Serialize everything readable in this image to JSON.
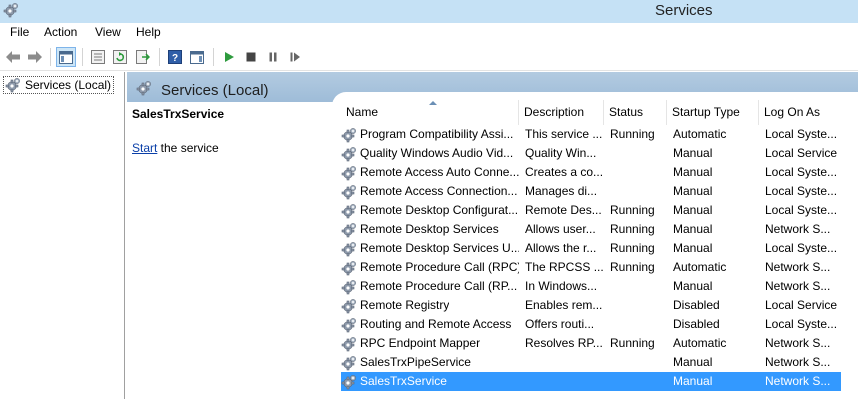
{
  "window": {
    "title": "Services"
  },
  "menu": [
    "File",
    "Action",
    "View",
    "Help"
  ],
  "tree": {
    "root_label": "Services (Local)"
  },
  "content_header": {
    "title": "Services (Local)"
  },
  "description_pane": {
    "service_name": "SalesTrxService",
    "start_link": "Start",
    "start_suffix": " the service"
  },
  "columns": [
    "Name",
    "Description",
    "Status",
    "Startup Type",
    "Log On As"
  ],
  "services": [
    {
      "name": "Program Compatibility Assi...",
      "description": "This service ...",
      "status": "Running",
      "startup": "Automatic",
      "logon": "Local Syste..."
    },
    {
      "name": "Quality Windows Audio Vid...",
      "description": "Quality Win...",
      "status": "",
      "startup": "Manual",
      "logon": "Local Service"
    },
    {
      "name": "Remote Access Auto Conne...",
      "description": "Creates a co...",
      "status": "",
      "startup": "Manual",
      "logon": "Local Syste..."
    },
    {
      "name": "Remote Access Connection...",
      "description": "Manages di...",
      "status": "",
      "startup": "Manual",
      "logon": "Local Syste..."
    },
    {
      "name": "Remote Desktop Configurat...",
      "description": "Remote Des...",
      "status": "Running",
      "startup": "Manual",
      "logon": "Local Syste..."
    },
    {
      "name": "Remote Desktop Services",
      "description": "Allows user...",
      "status": "Running",
      "startup": "Manual",
      "logon": "Network S..."
    },
    {
      "name": "Remote Desktop Services U...",
      "description": "Allows the r...",
      "status": "Running",
      "startup": "Manual",
      "logon": "Local Syste..."
    },
    {
      "name": "Remote Procedure Call (RPC)",
      "description": "The RPCSS ...",
      "status": "Running",
      "startup": "Automatic",
      "logon": "Network S..."
    },
    {
      "name": "Remote Procedure Call (RP...",
      "description": "In Windows...",
      "status": "",
      "startup": "Manual",
      "logon": "Network S..."
    },
    {
      "name": "Remote Registry",
      "description": "Enables rem...",
      "status": "",
      "startup": "Disabled",
      "logon": "Local Service"
    },
    {
      "name": "Routing and Remote Access",
      "description": "Offers routi...",
      "status": "",
      "startup": "Disabled",
      "logon": "Local Syste..."
    },
    {
      "name": "RPC Endpoint Mapper",
      "description": "Resolves RP...",
      "status": "Running",
      "startup": "Automatic",
      "logon": "Network S..."
    },
    {
      "name": "SalesTrxPipeService",
      "description": "",
      "status": "",
      "startup": "Manual",
      "logon": "Network S..."
    },
    {
      "name": "SalesTrxService",
      "description": "",
      "status": "",
      "startup": "Manual",
      "logon": "Network S...",
      "selected": true
    }
  ]
}
